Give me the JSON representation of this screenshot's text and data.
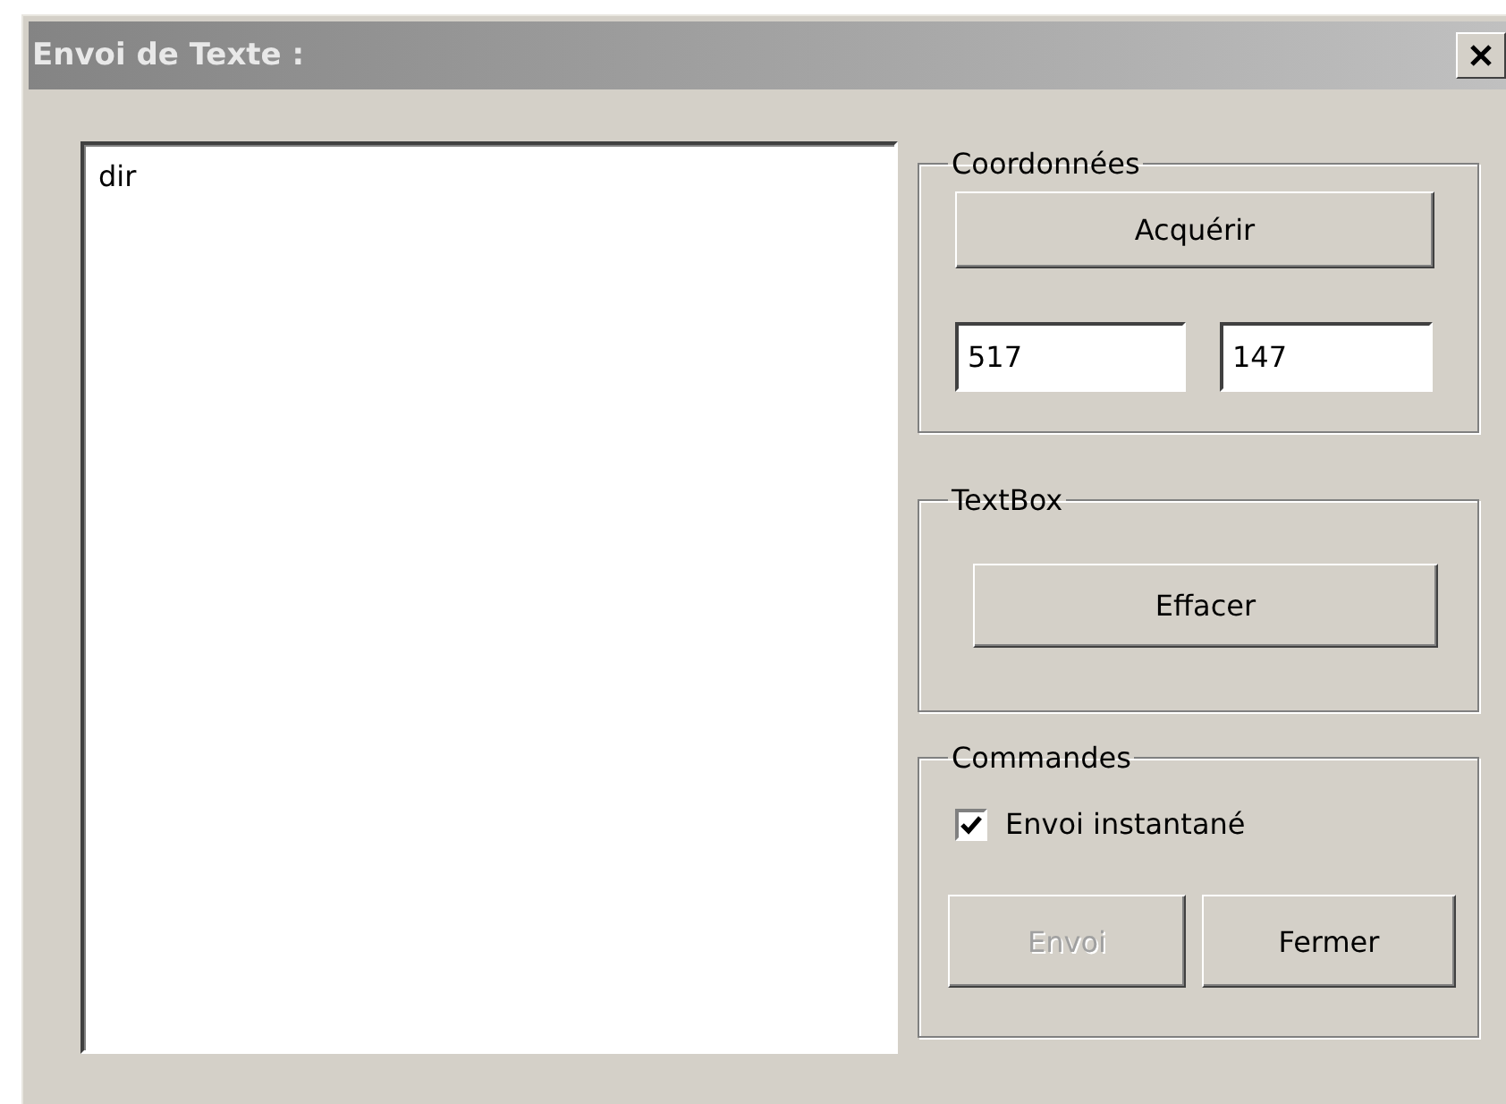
{
  "window": {
    "title": "Envoi de Texte :"
  },
  "text_area": {
    "value": "dir"
  },
  "coordinates": {
    "title": "Coordonnées",
    "acquire_button": "Acquérir",
    "x_value": "517",
    "y_value": "147"
  },
  "textbox_group": {
    "title": "TextBox",
    "clear_button": "Effacer"
  },
  "commands": {
    "title": "Commandes",
    "instant_send": {
      "label": "Envoi instantané",
      "checked": true
    },
    "buttons": [
      {
        "label": "Envoi",
        "disabled": true
      },
      {
        "label": "Fermer",
        "disabled": false
      }
    ]
  }
}
